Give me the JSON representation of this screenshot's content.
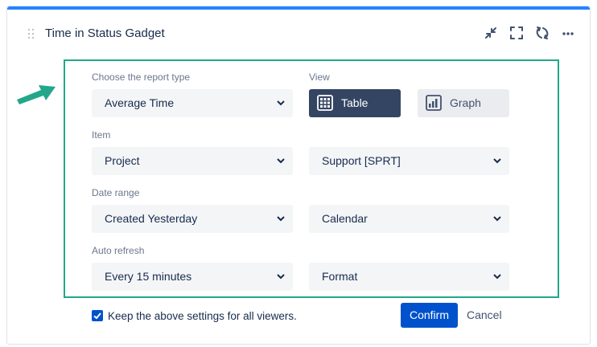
{
  "gadget": {
    "title": "Time in Status Gadget",
    "header_icons": [
      "minimize-icon",
      "fullscreen-icon",
      "refresh-icon",
      "more-icon"
    ]
  },
  "form": {
    "report_type": {
      "label": "Choose the report type",
      "value": "Average Time"
    },
    "view": {
      "label": "View",
      "options": [
        {
          "label": "Table",
          "icon": "table-icon",
          "active": true
        },
        {
          "label": "Graph",
          "icon": "graph-icon",
          "active": false
        }
      ]
    },
    "item": {
      "label": "Item",
      "type_value": "Project",
      "target_value": "Support [SPRT]"
    },
    "date_range": {
      "label": "Date range",
      "value": "Created Yesterday",
      "mode_value": "Calendar"
    },
    "auto_refresh": {
      "label": "Auto refresh",
      "value": "Every 15 minutes",
      "format_value": "Format"
    }
  },
  "footer": {
    "keep_settings_label": "Keep the above settings for all viewers.",
    "keep_settings_checked": true,
    "confirm_label": "Confirm",
    "cancel_label": "Cancel"
  },
  "colors": {
    "accent": "#0052cc",
    "top_bar": "#2684ff",
    "highlight": "#22a78a",
    "active_view": "#344563"
  }
}
